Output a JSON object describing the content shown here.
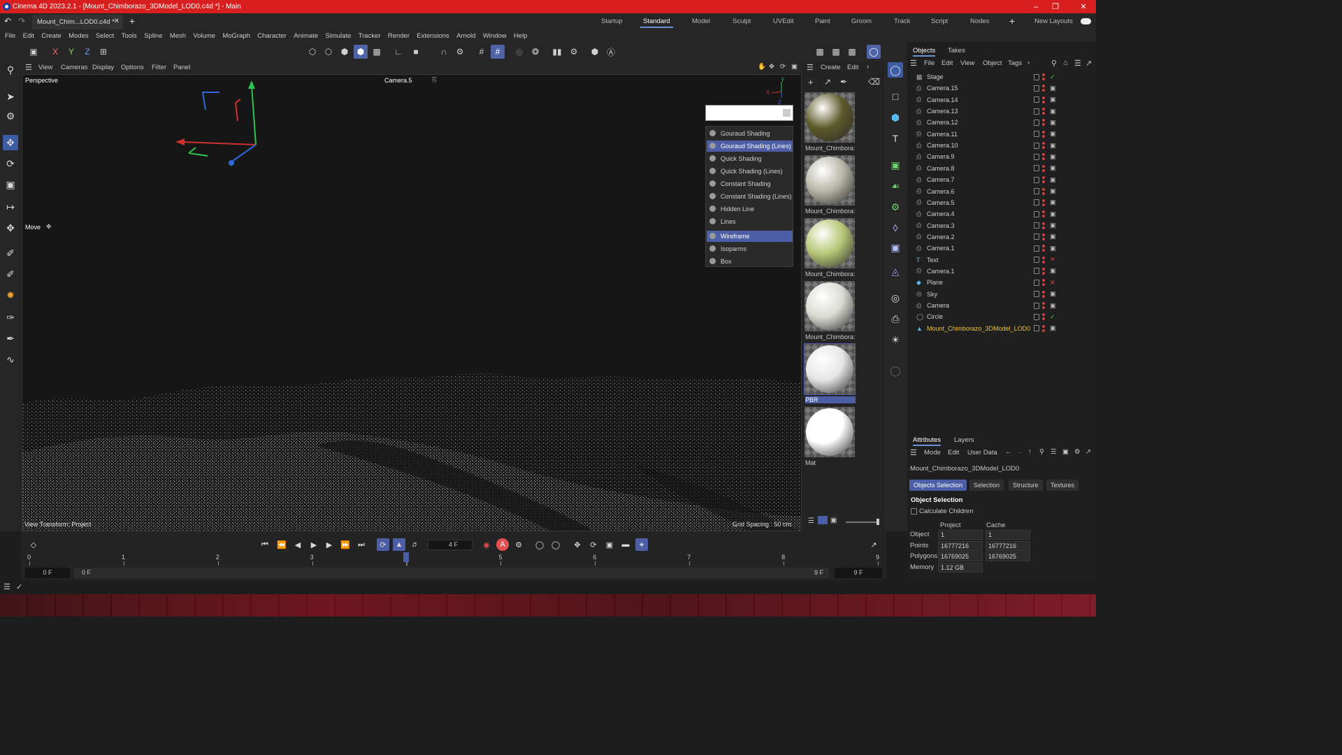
{
  "window": {
    "title": "Cinema 4D 2023.2.1 - [Mount_Chimborazo_3DModel_LOD0.c4d *] - Main"
  },
  "tabs": {
    "doc_tab": "Mount_Chim...LOD0.c4d *"
  },
  "layouts": [
    "Startup",
    "Standard",
    "Model",
    "Sculpt",
    "UVEdit",
    "Paint",
    "Groom",
    "Track",
    "Script",
    "Nodes"
  ],
  "layouts_extra": "New Layouts",
  "menu": [
    "File",
    "Edit",
    "Create",
    "Modes",
    "Select",
    "Tools",
    "Spline",
    "Mesh",
    "Volume",
    "MoGraph",
    "Character",
    "Animate",
    "Simulate",
    "Tracker",
    "Render",
    "Extensions",
    "Arnold",
    "Window",
    "Help"
  ],
  "axis_buttons": [
    "X",
    "Y",
    "Z"
  ],
  "viewport": {
    "menu": [
      "View",
      "Cameras",
      "Display",
      "Options",
      "Filter",
      "Panel"
    ],
    "label": "Perspective",
    "camera": "Camera.5",
    "tool": "Move",
    "transform": "View Transform: Project",
    "grid": "Grid Spacing : 50 cm",
    "axis_x": "X",
    "axis_y": "Y",
    "axis_z": "Z"
  },
  "shading_menu": [
    {
      "label": "Gouraud Shading",
      "active": false
    },
    {
      "label": "Gouraud Shading (Lines)",
      "active": true
    },
    {
      "label": "Quick Shading",
      "active": false
    },
    {
      "label": "Quick Shading (Lines)",
      "active": false
    },
    {
      "label": "Constant Shading",
      "active": false
    },
    {
      "label": "Constant Shading (Lines)",
      "active": false
    },
    {
      "label": "Hidden Line",
      "active": false
    },
    {
      "label": "Lines",
      "active": false
    },
    {
      "label": "Wireframe",
      "active": true
    },
    {
      "label": "Isoparms",
      "active": false
    },
    {
      "label": "Box",
      "active": false
    }
  ],
  "materials": {
    "menu": [
      "Create",
      "Edit"
    ],
    "items": [
      {
        "label": "Mount_Chimbora:",
        "color": "#5d5a2a"
      },
      {
        "label": "Mount_Chimbora:",
        "color": "#b9b7a8"
      },
      {
        "label": "Mount_Chimbora:",
        "color": "#b7c776"
      },
      {
        "label": "Mount_Chimbora:",
        "color": "#d9dcd2"
      },
      {
        "label": "PBR",
        "color": "#e6e6e6"
      },
      {
        "label": "Mat",
        "color": "#ffffff"
      }
    ]
  },
  "objects_panel": {
    "tabs": [
      "Objects",
      "Takes"
    ],
    "menu": [
      "File",
      "Edit",
      "View",
      "Object",
      "Tags"
    ],
    "items": [
      {
        "name": "Stage",
        "icon": "stage"
      },
      {
        "name": "Camera.15",
        "icon": "camera"
      },
      {
        "name": "Camera.14",
        "icon": "camera"
      },
      {
        "name": "Camera.13",
        "icon": "camera"
      },
      {
        "name": "Camera.12",
        "icon": "camera"
      },
      {
        "name": "Camera.11",
        "icon": "camera"
      },
      {
        "name": "Camera.10",
        "icon": "camera"
      },
      {
        "name": "Camera.9",
        "icon": "camera"
      },
      {
        "name": "Camera.8",
        "icon": "camera"
      },
      {
        "name": "Camera.7",
        "icon": "camera"
      },
      {
        "name": "Camera.6",
        "icon": "camera"
      },
      {
        "name": "Camera.5",
        "icon": "camera"
      },
      {
        "name": "Camera.4",
        "icon": "camera"
      },
      {
        "name": "Camera.3",
        "icon": "camera"
      },
      {
        "name": "Camera.2",
        "icon": "camera"
      },
      {
        "name": "Camera.1",
        "icon": "camera"
      },
      {
        "name": "Text",
        "icon": "text"
      },
      {
        "name": "Camera.1",
        "icon": "camera"
      },
      {
        "name": "Plane",
        "icon": "plane"
      },
      {
        "name": "Sky",
        "icon": "sky"
      },
      {
        "name": "Camera",
        "icon": "camera"
      },
      {
        "name": "Circle",
        "icon": "circle"
      },
      {
        "name": "Mount_Chimborazo_3DModel_LOD0",
        "icon": "mesh",
        "highlight": true
      }
    ]
  },
  "attributes": {
    "tabs": [
      "Attributes",
      "Layers"
    ],
    "menu": [
      "Mode",
      "Edit",
      "User Data"
    ],
    "object_name": "Mount_Chimborazo_3DModel_LOD0",
    "subtabs": [
      "Objects Selection",
      "Selection",
      "Structure",
      "Textures"
    ],
    "section": "Object Selection",
    "calc_children": "Calculate Children",
    "col_project": "Project",
    "col_cache": "Cache",
    "rows": [
      {
        "label": "Object",
        "project": "1",
        "cache": "1"
      },
      {
        "label": "Points",
        "project": "16777216",
        "cache": "16777216"
      },
      {
        "label": "Polygons",
        "project": "16769025",
        "cache": "16769025"
      },
      {
        "label": "Memory",
        "project": "1.12 GB",
        "cache": ""
      }
    ]
  },
  "timeline": {
    "current_frame": "4 F",
    "ticks": [
      "0",
      "1",
      "2",
      "3",
      "4",
      "5",
      "6",
      "7",
      "8",
      "9"
    ],
    "start": "0 F",
    "start2": "0 F",
    "end": "9 F",
    "end2": "9 F"
  },
  "colors": {
    "title_bar": "#d81f1f",
    "accent": "#4b5ea6"
  }
}
